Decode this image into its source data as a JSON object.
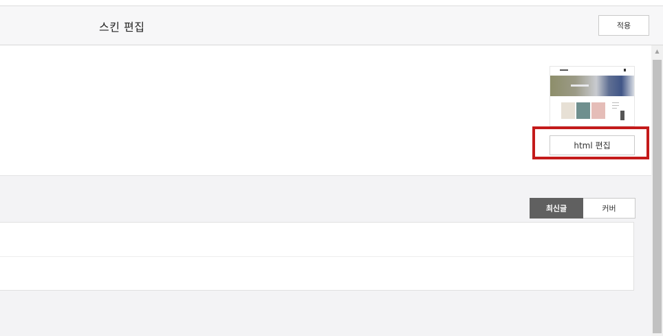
{
  "header": {
    "title": "스킨 편집",
    "apply_label": "적용"
  },
  "skin": {
    "thumbnail_icon": "skin-preview-image",
    "html_edit_label": "html 편집",
    "highlight_color": "#c41a1a"
  },
  "tabs": [
    {
      "label": "최신글",
      "selected": true
    },
    {
      "label": "커버",
      "selected": false
    }
  ],
  "list": {
    "rows": [
      "",
      ""
    ]
  },
  "scrollbar": {
    "up_icon": "arrow-up-icon"
  },
  "colors": {
    "selected_tab_bg": "#606060",
    "header_bg": "#f7f7f8",
    "lower_bg": "#f3f3f5"
  }
}
